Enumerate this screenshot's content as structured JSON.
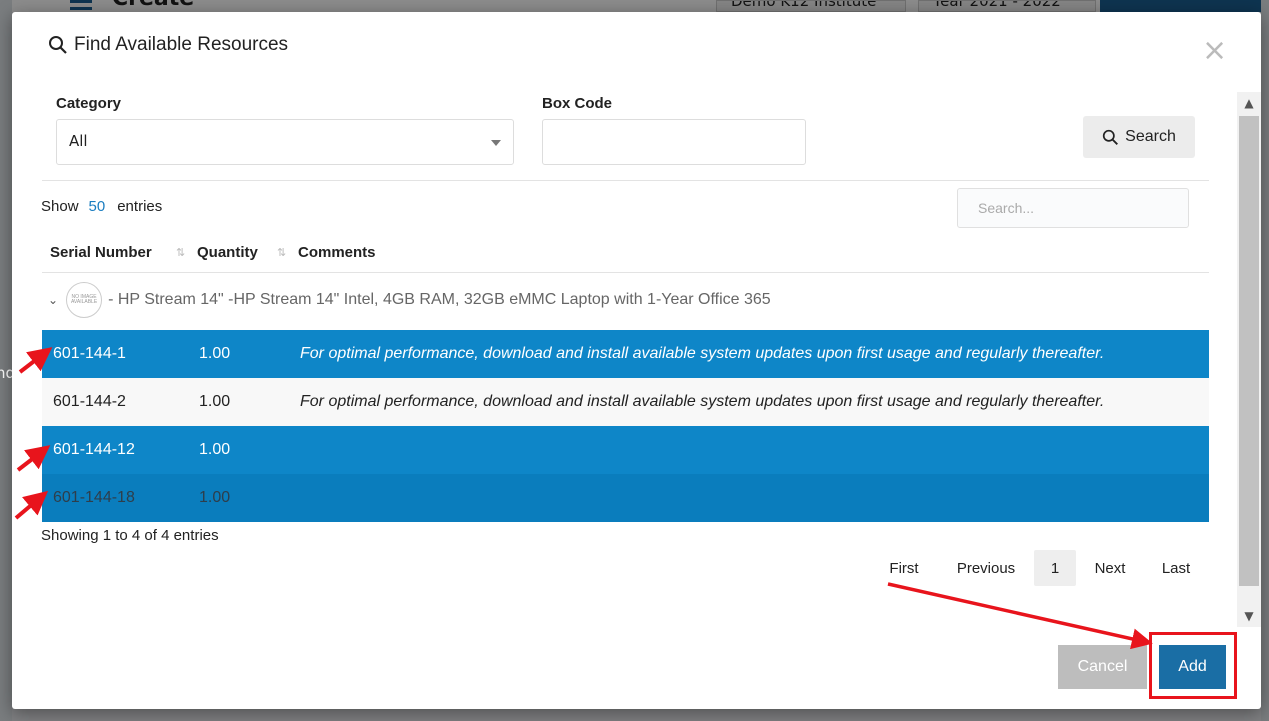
{
  "background": {
    "page_title": "Create",
    "institution": "Demo K12 Institute",
    "year": "Year 2021 - 2022",
    "edge_text": "nd"
  },
  "modal": {
    "title": "Find Available Resources",
    "close_symbol": "×",
    "category": {
      "label": "Category",
      "value": "All"
    },
    "box_code": {
      "label": "Box Code",
      "value": ""
    },
    "search_button": "Search",
    "show": {
      "prefix": "Show",
      "count": "50",
      "suffix": "entries"
    },
    "table_search_placeholder": "Search...",
    "columns": [
      "Serial Number",
      "Quantity",
      "Comments"
    ],
    "group": {
      "image_text": "NO IMAGE AVAILABLE",
      "label": "- HP Stream 14\" -HP Stream 14\" Intel, 4GB RAM, 32GB eMMC Laptop with 1-Year Office 365"
    },
    "rows": [
      {
        "serial": "601-144-1",
        "qty": "1.00",
        "comment": "For optimal performance, download and install available system updates upon first usage and regularly thereafter.",
        "selected": true
      },
      {
        "serial": "601-144-2",
        "qty": "1.00",
        "comment": "For optimal performance, download and install available system updates upon first usage and regularly thereafter.",
        "selected": false
      },
      {
        "serial": "601-144-12",
        "qty": "1.00",
        "comment": "",
        "selected": true
      },
      {
        "serial": "601-144-18",
        "qty": "1.00",
        "comment": "",
        "selected": true
      }
    ],
    "showing": "Showing 1 to 4 of 4 entries",
    "pagination": {
      "first": "First",
      "previous": "Previous",
      "current": "1",
      "next": "Next",
      "last": "Last"
    },
    "cancel_button": "Cancel",
    "add_button": "Add"
  },
  "colors": {
    "selected_row": "#0e86c8",
    "primary_button": "#1a6ea5",
    "annotation": "#e8141c"
  }
}
